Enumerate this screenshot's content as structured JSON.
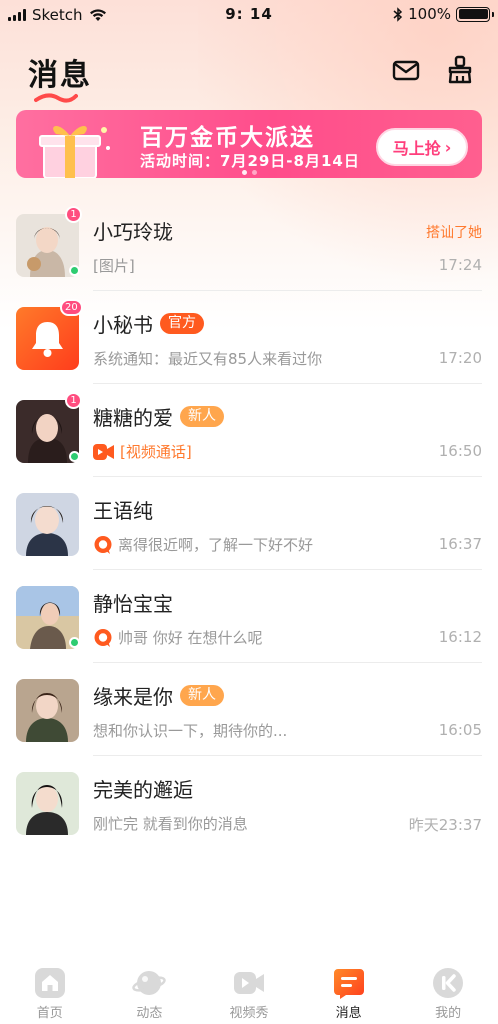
{
  "status_bar": {
    "carrier": "Sketch",
    "time": "9: 14",
    "battery": "100%"
  },
  "header": {
    "title": "消息",
    "icons": [
      "mail-icon",
      "broom-icon"
    ]
  },
  "banner": {
    "title": "百万金币大派送",
    "subtitle": "活动时间：7月29日-8月14日",
    "button_label": "马上抢",
    "button_arrow": "›"
  },
  "conversations": [
    {
      "name": "小巧玲珑",
      "message": "[图片]",
      "time": "17:24",
      "badge": "1",
      "online": true,
      "action": "搭讪了她",
      "tag": "",
      "msg_icon": ""
    },
    {
      "name": "小秘书",
      "message": "系统通知：最近又有85人来看过你",
      "time": "17:20",
      "badge": "20",
      "online": false,
      "action": "",
      "tag": "官方",
      "msg_icon": ""
    },
    {
      "name": "糖糖的爱",
      "message": "[视频通话]",
      "time": "16:50",
      "badge": "1",
      "online": true,
      "action": "",
      "tag": "新人",
      "msg_icon": "video-call-icon"
    },
    {
      "name": "王语纯",
      "message": "离得很近啊，了解一下好不好",
      "time": "16:37",
      "badge": "",
      "online": false,
      "action": "",
      "tag": "",
      "msg_icon": "chat-bubble-icon"
    },
    {
      "name": "静怡宝宝",
      "message": "帅哥 你好 在想什么呢",
      "time": "16:12",
      "badge": "",
      "online": true,
      "action": "",
      "tag": "",
      "msg_icon": "chat-bubble-icon"
    },
    {
      "name": "缘来是你",
      "message": "想和你认识一下，期待你的...",
      "time": "16:05",
      "badge": "",
      "online": false,
      "action": "",
      "tag": "新人",
      "msg_icon": ""
    },
    {
      "name": "完美的邂逅",
      "message": "刚忙完 就看到你的消息",
      "time": "昨天23:37",
      "badge": "",
      "online": false,
      "action": "",
      "tag": "",
      "msg_icon": ""
    }
  ],
  "tabs": [
    {
      "label": "首页",
      "icon": "home-icon",
      "active": false
    },
    {
      "label": "动态",
      "icon": "planet-icon",
      "active": false
    },
    {
      "label": "视频秀",
      "icon": "video-icon",
      "active": false
    },
    {
      "label": "消息",
      "icon": "message-icon",
      "active": true
    },
    {
      "label": "我的",
      "icon": "profile-icon",
      "active": false
    }
  ],
  "colors": {
    "accent": "#ff5a1f",
    "banner": "#ff4d8b",
    "online": "#2ecc71",
    "badge": "#ff4d7f"
  }
}
